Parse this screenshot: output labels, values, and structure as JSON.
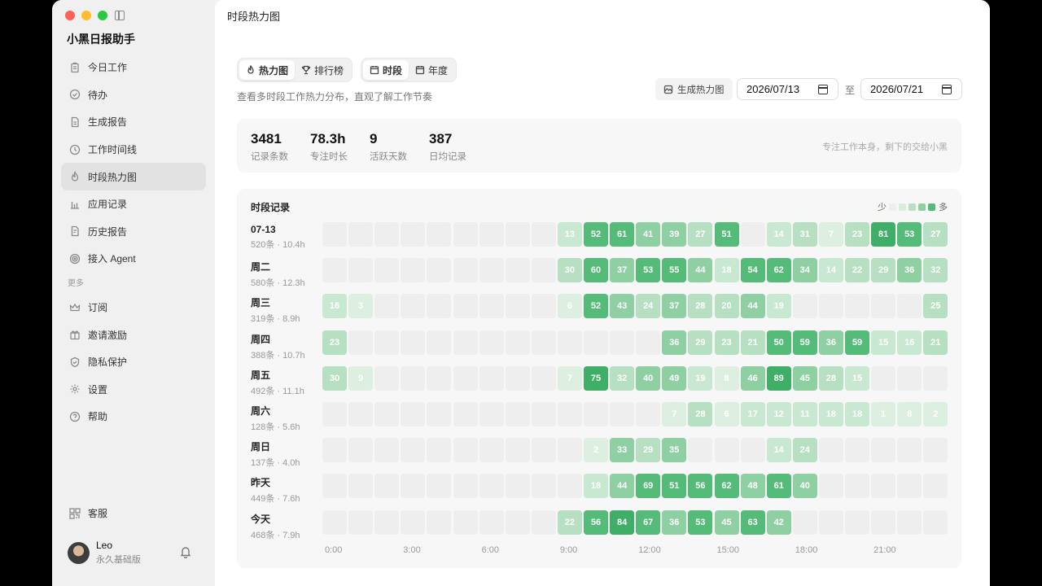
{
  "app": {
    "title": "小黑日报助手"
  },
  "sidebar": {
    "items": [
      {
        "label": "今日工作",
        "icon": "clipboard-icon",
        "name": "today-work"
      },
      {
        "label": "待办",
        "icon": "check-circle-icon",
        "name": "todo"
      },
      {
        "label": "生成报告",
        "icon": "document-icon",
        "name": "generate-report"
      },
      {
        "label": "工作时间线",
        "icon": "clock-icon",
        "name": "timeline"
      },
      {
        "label": "时段热力图",
        "icon": "flame-icon",
        "name": "heatmap",
        "active": true
      },
      {
        "label": "应用记录",
        "icon": "bar-chart-icon",
        "name": "app-records"
      },
      {
        "label": "历史报告",
        "icon": "history-report-icon",
        "name": "history-reports"
      },
      {
        "label": "接入 Agent",
        "icon": "agent-icon",
        "name": "connect-agent"
      }
    ],
    "section_more": "更多",
    "more_items": [
      {
        "label": "订阅",
        "icon": "crown-icon",
        "name": "subscribe"
      },
      {
        "label": "邀请激励",
        "icon": "gift-icon",
        "name": "invite"
      },
      {
        "label": "隐私保护",
        "icon": "shield-icon",
        "name": "privacy"
      },
      {
        "label": "设置",
        "icon": "gear-icon",
        "name": "settings"
      },
      {
        "label": "帮助",
        "icon": "help-icon",
        "name": "help"
      }
    ],
    "service": "客服",
    "user": {
      "name": "Leo",
      "plan": "永久基础版"
    }
  },
  "main": {
    "title": "时段热力图",
    "view_tabs": [
      {
        "label": "热力图",
        "icon": "flame-icon",
        "active": true
      },
      {
        "label": "排行榜",
        "icon": "trophy-icon",
        "active": false
      }
    ],
    "range_tabs": [
      {
        "label": "时段",
        "icon": "calendar-icon",
        "active": true
      },
      {
        "label": "年度",
        "icon": "calendar-icon",
        "active": false
      }
    ],
    "subtitle": "查看多时段工作热力分布，直观了解工作节奏",
    "generate_button": "生成热力图",
    "date_from": "2026/07/13",
    "date_sep": "至",
    "date_to": "2026/07/21"
  },
  "stats": {
    "items": [
      {
        "value": "3481",
        "label": "记录条数"
      },
      {
        "value": "78.3h",
        "label": "专注时长"
      },
      {
        "value": "9",
        "label": "活跃天数"
      },
      {
        "value": "387",
        "label": "日均记录"
      }
    ],
    "slogan": "专注工作本身，剩下的交给小黑"
  },
  "heatmap": {
    "title": "时段记录",
    "legend_less": "少",
    "legend_more": "多",
    "legend_colors": [
      "#eeeeee",
      "#d8eedd",
      "#b6e0c1",
      "#8fd0a2",
      "#55bb78"
    ],
    "x_labels": [
      "0:00",
      "3:00",
      "6:00",
      "9:00",
      "12:00",
      "15:00",
      "18:00",
      "21:00"
    ],
    "rows": [
      {
        "name": "07-13",
        "sub": "520条 · 10.4h",
        "values": [
          null,
          null,
          null,
          null,
          null,
          null,
          null,
          null,
          null,
          13,
          52,
          61,
          41,
          39,
          27,
          51,
          null,
          14,
          31,
          7,
          23,
          81,
          53,
          27
        ]
      },
      {
        "name": "周二",
        "sub": "580条 · 12.3h",
        "values": [
          null,
          null,
          null,
          null,
          null,
          null,
          null,
          null,
          null,
          30,
          60,
          37,
          53,
          55,
          44,
          18,
          54,
          62,
          34,
          14,
          22,
          29,
          36,
          32
        ]
      },
      {
        "name": "周三",
        "sub": "319条 · 8.9h",
        "values": [
          16,
          3,
          null,
          null,
          null,
          null,
          null,
          null,
          null,
          6,
          52,
          43,
          24,
          37,
          28,
          20,
          44,
          19,
          null,
          null,
          null,
          null,
          null,
          25
        ]
      },
      {
        "name": "周四",
        "sub": "388条 · 10.7h",
        "values": [
          23,
          null,
          null,
          null,
          null,
          null,
          null,
          null,
          null,
          null,
          null,
          null,
          null,
          36,
          29,
          23,
          21,
          50,
          59,
          36,
          59,
          15,
          16,
          21
        ]
      },
      {
        "name": "周五",
        "sub": "492条 · 11.1h",
        "values": [
          30,
          9,
          null,
          null,
          null,
          null,
          null,
          null,
          null,
          7,
          75,
          32,
          40,
          49,
          19,
          8,
          46,
          89,
          45,
          28,
          15,
          null,
          null,
          null
        ]
      },
      {
        "name": "周六",
        "sub": "128条 · 5.6h",
        "values": [
          null,
          null,
          null,
          null,
          null,
          null,
          null,
          null,
          null,
          null,
          null,
          null,
          null,
          7,
          28,
          6,
          17,
          12,
          11,
          18,
          18,
          1,
          8,
          2
        ]
      },
      {
        "name": "周日",
        "sub": "137条 · 4.0h",
        "values": [
          null,
          null,
          null,
          null,
          null,
          null,
          null,
          null,
          null,
          null,
          2,
          33,
          29,
          35,
          null,
          null,
          null,
          14,
          24,
          null,
          null,
          null,
          null,
          null
        ]
      },
      {
        "name": "昨天",
        "sub": "449条 · 7.6h",
        "values": [
          null,
          null,
          null,
          null,
          null,
          null,
          null,
          null,
          null,
          null,
          18,
          44,
          69,
          51,
          56,
          62,
          48,
          61,
          40,
          null,
          null,
          null,
          null,
          null
        ]
      },
      {
        "name": "今天",
        "sub": "468条 · 7.9h",
        "values": [
          null,
          null,
          null,
          null,
          null,
          null,
          null,
          null,
          null,
          22,
          56,
          84,
          67,
          36,
          53,
          45,
          63,
          42,
          null,
          null,
          null,
          null,
          null,
          null
        ]
      }
    ]
  }
}
